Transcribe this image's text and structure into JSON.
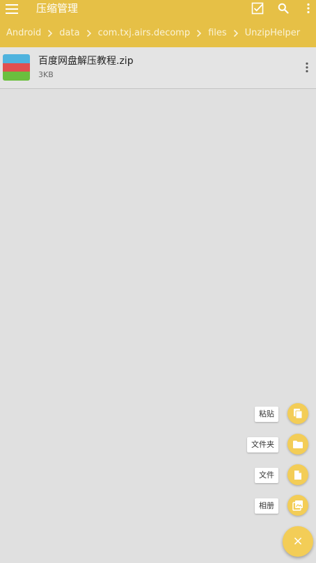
{
  "app_bar": {
    "title": "压缩管理",
    "background_color": "#e6c046",
    "icons": [
      "menu-icon",
      "select-all-icon",
      "search-icon",
      "more-vert-icon"
    ]
  },
  "breadcrumb": {
    "items": [
      {
        "label": "Android"
      },
      {
        "label": "data"
      },
      {
        "label": "com.txj.airs.decomp"
      },
      {
        "label": "files"
      },
      {
        "label": "UnzipHelper"
      }
    ],
    "separator_icon": "chevron-right-icon"
  },
  "files": [
    {
      "name": "百度网盘解压教程.zip",
      "size": "3KB",
      "icon": "zip-archive-icon",
      "thumb_colors": [
        "#4fb3de",
        "#e05050",
        "#6bbf3e"
      ]
    }
  ],
  "speed_dial": {
    "accent_color": "#f3cd57",
    "actions": [
      {
        "label": "粘贴",
        "icon": "paste-icon"
      },
      {
        "label": "文件夹",
        "icon": "folder-icon"
      },
      {
        "label": "文件",
        "icon": "file-icon"
      },
      {
        "label": "相册",
        "icon": "photo-album-icon"
      }
    ],
    "main_button_label": "×",
    "main_button_icon": "close-icon"
  }
}
